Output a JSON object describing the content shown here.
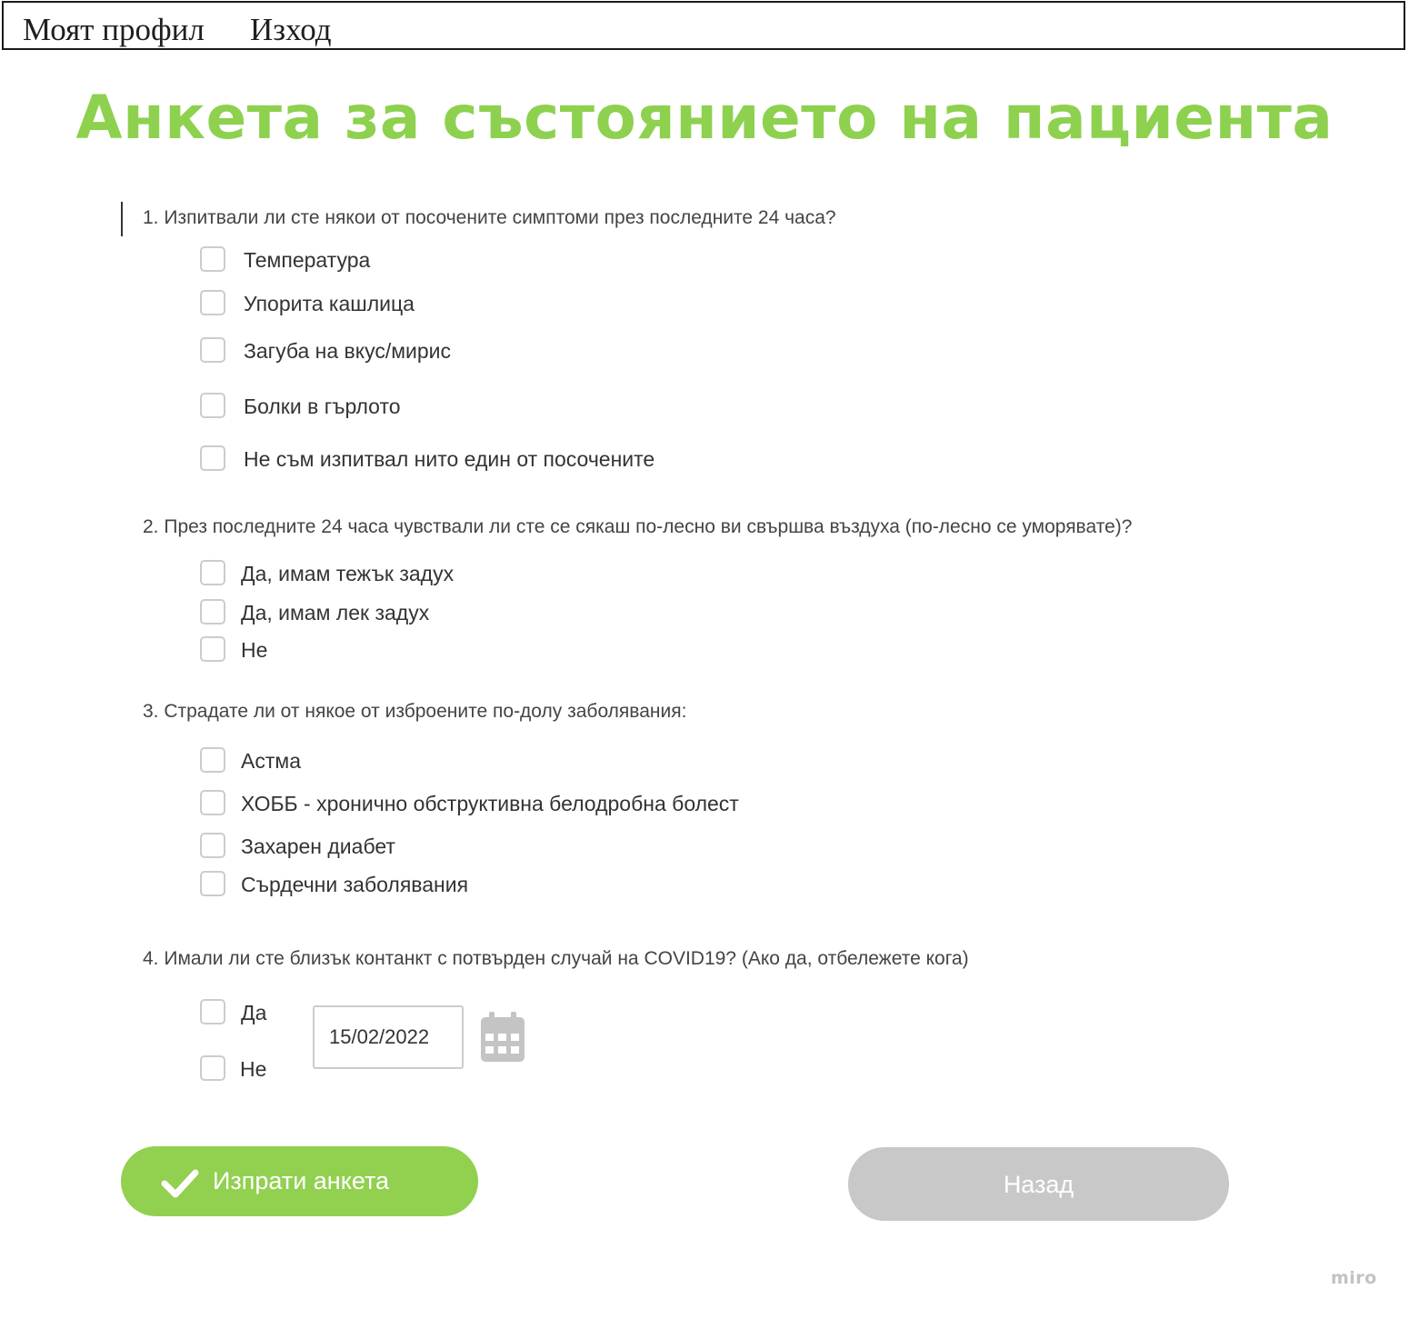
{
  "nav": {
    "profile_label": "Моят профил",
    "logout_label": "Изход"
  },
  "title": "Анкета за състоянието на пациента",
  "questions": [
    {
      "text": "1. Изпитвали ли сте някои от посочените симптоми през последните 24 часа?",
      "options": [
        {
          "label": "Температура",
          "checked": false
        },
        {
          "label": "Упорита кашлица",
          "checked": false
        },
        {
          "label": "Загуба на вкус/мирис",
          "checked": false
        },
        {
          "label": "Болки в гърлото",
          "checked": false
        },
        {
          "label": "Не съм изпитвал нито един от посочените",
          "checked": false
        }
      ]
    },
    {
      "text": "2. През последните 24 часа чувствали ли сте се сякаш по-лесно ви свършва въздуха (по-лесно се уморявате)?",
      "options": [
        {
          "label": "Да, имам тежък задух",
          "checked": false
        },
        {
          "label": "Да, имам лек задух",
          "checked": false
        },
        {
          "label": "Не",
          "checked": false
        }
      ]
    },
    {
      "text": "3. Страдате ли от някое от изброените по-долу заболявания:",
      "options": [
        {
          "label": "Астма",
          "checked": false
        },
        {
          "label": "ХОББ - хронично обструктивна белодробна болест",
          "checked": false
        },
        {
          "label": "Захарен диабет",
          "checked": false
        },
        {
          "label": "Сърдечни заболявания",
          "checked": false
        }
      ]
    },
    {
      "text": "4. Имали ли сте близък контанкт с потвърден случай на COVID19? (Ако да, отбележете кога)",
      "options": [
        {
          "label": "Да",
          "checked": false
        },
        {
          "label": "Не",
          "checked": false
        }
      ],
      "date_value": "15/02/2022"
    }
  ],
  "buttons": {
    "submit_label": "Изпрати анкета",
    "back_label": "Назад"
  },
  "icons": {
    "submit": "check-icon",
    "date": "calendar-icon"
  },
  "colors": {
    "accent_green": "#8dd14f",
    "button_green": "#92d050",
    "button_gray": "#c8c8c8",
    "checkbox_border": "#cccccc"
  },
  "watermark": "miro"
}
